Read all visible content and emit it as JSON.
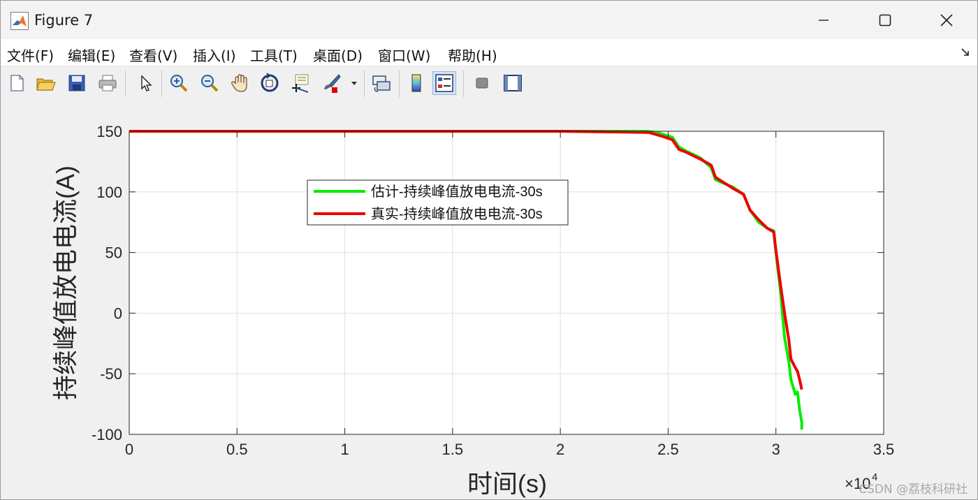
{
  "window": {
    "title": "Figure 7"
  },
  "menu": {
    "items": [
      "文件(F)",
      "编辑(E)",
      "查看(V)",
      "插入(I)",
      "工具(T)",
      "桌面(D)",
      "窗口(W)",
      "帮助(H)"
    ]
  },
  "toolbar": {
    "buttons": [
      {
        "icon": "new-figure-icon"
      },
      {
        "icon": "open-file-icon"
      },
      {
        "icon": "save-icon"
      },
      {
        "icon": "print-icon"
      },
      {
        "icon": "edit-plot-arrow-icon"
      },
      {
        "icon": "zoom-in-icon"
      },
      {
        "icon": "zoom-out-icon"
      },
      {
        "icon": "pan-hand-icon"
      },
      {
        "icon": "rotate-3d-icon"
      },
      {
        "icon": "data-cursor-icon"
      },
      {
        "icon": "brush-icon"
      },
      {
        "icon": "link-plot-icon"
      },
      {
        "icon": "colorbar-icon"
      },
      {
        "icon": "legend-icon"
      },
      {
        "icon": "hide-plot-tools-icon"
      },
      {
        "icon": "show-plot-tools-icon"
      }
    ]
  },
  "chart_data": {
    "type": "line",
    "xlabel": "时间(s)",
    "ylabel": "持续峰值放电电流(A)",
    "x_exponent_label": "×10",
    "x_exponent_power": "4",
    "xlim": [
      0,
      3.5
    ],
    "ylim": [
      -100,
      150
    ],
    "xticks": [
      "0",
      "0.5",
      "1",
      "1.5",
      "2",
      "2.5",
      "3",
      "3.5"
    ],
    "yticks": [
      "150",
      "100",
      "50",
      "0",
      "-50",
      "-100"
    ],
    "grid": true,
    "legend_position": "upper-middle",
    "series": [
      {
        "name": "估计-持续峰值放电电流-30s",
        "color": "#00ee00",
        "x": [
          0,
          0.5,
          1.0,
          1.5,
          2.0,
          2.4,
          2.45,
          2.52,
          2.55,
          2.58,
          2.65,
          2.7,
          2.72,
          2.8,
          2.85,
          2.88,
          2.92,
          2.96,
          2.99,
          3.0,
          3.02,
          3.04,
          3.06,
          3.07,
          3.09,
          3.1,
          3.11,
          3.12,
          3.12
        ],
        "y": [
          150,
          150,
          150,
          150,
          150,
          150,
          149,
          145,
          137,
          134,
          128,
          120,
          110,
          104,
          98,
          85,
          75,
          70,
          68,
          50,
          20,
          -20,
          -40,
          -55,
          -67,
          -65,
          -80,
          -90,
          -96
        ]
      },
      {
        "name": "真实-持续峰值放电电流-30s",
        "color": "#ee0000",
        "x": [
          0,
          0.5,
          1.0,
          1.5,
          2.0,
          2.41,
          2.47,
          2.52,
          2.55,
          2.58,
          2.65,
          2.7,
          2.72,
          2.8,
          2.85,
          2.88,
          2.92,
          2.96,
          2.99,
          3.0,
          3.02,
          3.04,
          3.06,
          3.07,
          3.09,
          3.1,
          3.11,
          3.12
        ],
        "y": [
          150,
          150,
          150,
          150,
          150,
          149,
          146,
          143,
          135,
          133,
          127,
          122,
          112,
          103,
          98,
          85,
          77,
          70,
          67,
          52,
          25,
          0,
          -22,
          -38,
          -45,
          -48,
          -55,
          -63
        ]
      }
    ]
  },
  "watermark": "CSDN @荔枝科研社"
}
